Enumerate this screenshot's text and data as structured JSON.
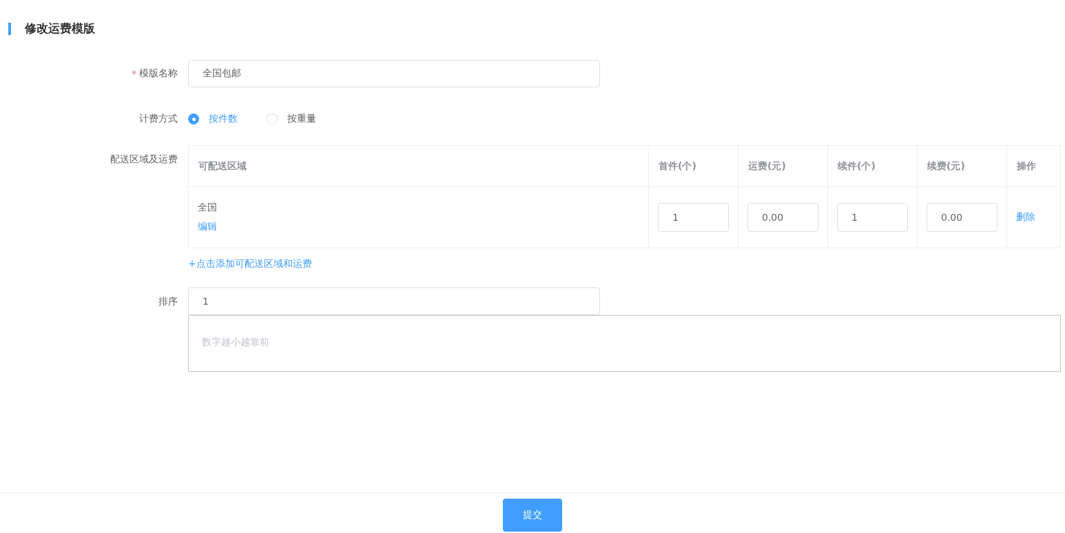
{
  "header": {
    "title": "修改运费模版"
  },
  "name_field": {
    "label": "模版名称",
    "required_mark": "*",
    "value": "全国包邮"
  },
  "billing": {
    "label": "计费方式",
    "options": [
      {
        "label": "按件数",
        "selected": true
      },
      {
        "label": "按重量",
        "selected": false
      }
    ]
  },
  "shipping": {
    "label": "配送区域及运费",
    "columns": [
      "可配送区域",
      "首件(个)",
      "运费(元)",
      "续件(个)",
      "续费(元)",
      "操作"
    ],
    "rows": [
      {
        "area": "全国",
        "edit": "编辑",
        "first_count": "1",
        "first_fee": "0.00",
        "extra_count": "1",
        "extra_fee": "0.00",
        "action": "删除"
      }
    ],
    "add_link": "+点击添加可配送区域和运费"
  },
  "sort_field": {
    "label": "排序",
    "value": "1",
    "hint_placeholder": "数字越小越靠前"
  },
  "footer": {
    "submit": "提交"
  }
}
